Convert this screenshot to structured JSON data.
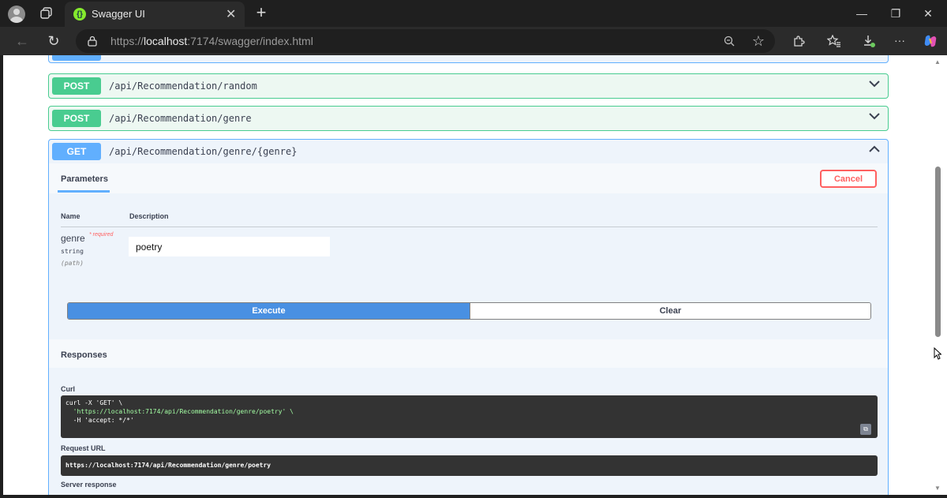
{
  "browser": {
    "tab_title": "Swagger UI",
    "tab_favicon": "swagger-logo",
    "url_scheme": "https://",
    "url_host": "localhost",
    "url_path": ":7174/swagger/index.html",
    "icons": {
      "profile": "avatar",
      "workspaces": "workspaces-icon",
      "new_tab": "+",
      "minimize": "—",
      "restore": "❐",
      "close": "✕",
      "back": "←",
      "refresh": "↻",
      "lock": "lock-icon",
      "zoom": "zoom-icon",
      "favorite": "☆",
      "extensions": "puzzle-icon",
      "favorites_list": "favorites-icon",
      "downloads": "download-icon",
      "more": "···",
      "copilot": "copilot-icon"
    }
  },
  "operations": [
    {
      "method": "POST",
      "path": "/api/Recommendation/random",
      "expanded": false
    },
    {
      "method": "POST",
      "path": "/api/Recommendation/genre",
      "expanded": false
    },
    {
      "method": "GET",
      "path": "/api/Recommendation/genre/{genre}",
      "expanded": true
    }
  ],
  "get_operation": {
    "parameters_tab": "Parameters",
    "cancel_label": "Cancel",
    "columns": {
      "name": "Name",
      "description": "Description"
    },
    "parameter": {
      "name": "genre",
      "required": "* required",
      "type": "string",
      "in": "(path)",
      "value": "poetry"
    },
    "execute_label": "Execute",
    "clear_label": "Clear",
    "responses_title": "Responses",
    "curl_label": "Curl",
    "curl_lines": [
      "curl -X 'GET' \\",
      "  'https://localhost:7174/api/Recommendation/genre/poetry' \\",
      "  -H 'accept: */*'"
    ],
    "request_url_label": "Request URL",
    "request_url": "https://localhost:7174/api/Recommendation/genre/poetry",
    "server_response_label": "Server response"
  },
  "colors": {
    "post": "#49cc90",
    "get": "#61affe",
    "execute": "#4990e2",
    "cancel": "#ff6060"
  }
}
